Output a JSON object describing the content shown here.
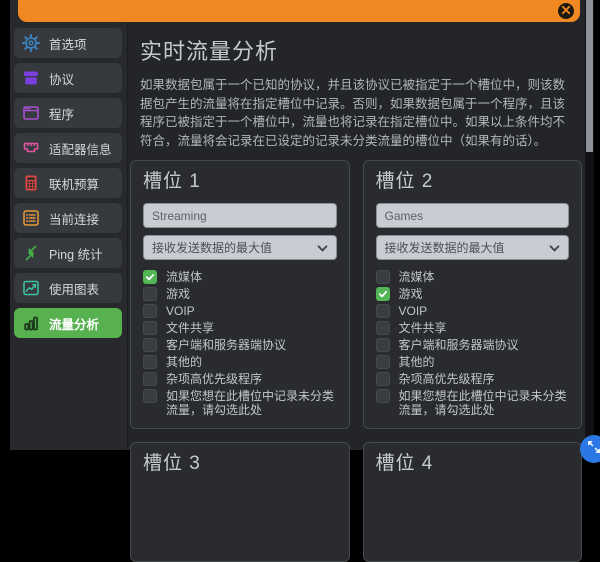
{
  "banner": {
    "close_icon": "✕",
    "color": "#f08921"
  },
  "sidebar": {
    "items": [
      {
        "id": "preferences",
        "label": "首选项",
        "icon": "gear-icon",
        "color": "#3a86c8",
        "active": false
      },
      {
        "id": "protocols",
        "label": "协议",
        "icon": "protocol-box-icon",
        "color": "#7d3ee0",
        "active": false
      },
      {
        "id": "programs",
        "label": "程序",
        "icon": "app-window-icon",
        "color": "#a94fd2",
        "active": false
      },
      {
        "id": "adapter-info",
        "label": "适配器信息",
        "icon": "ethernet-port-icon",
        "color": "#e0559f",
        "active": false
      },
      {
        "id": "online-budget",
        "label": "联机预算",
        "icon": "calculator-icon",
        "color": "#d84b44",
        "active": false
      },
      {
        "id": "current-connections",
        "label": "当前连接",
        "icon": "connection-list-icon",
        "color": "#e89b3c",
        "active": false
      },
      {
        "id": "ping-stats",
        "label": "Ping 统计",
        "icon": "ping-arrows-icon",
        "color": "#46b04a",
        "active": false
      },
      {
        "id": "usage-chart",
        "label": "使用图表",
        "icon": "line-chart-icon",
        "color": "#3cc29e",
        "active": false
      },
      {
        "id": "traffic-analysis",
        "label": "流量分析",
        "icon": "bar-chart-icon",
        "color": "#1d3a1d",
        "active": true
      }
    ]
  },
  "main": {
    "title": "实时流量分析",
    "description": "如果数据包属于一个已知的协议，并且该协议已被指定于一个槽位中，则该数据包产生的流量将在指定槽位中记录。否则，如果数据包属于一个程序，且该程序已被指定于一个槽位中，流量也将记录在指定槽位中。如果以上条件均不符合，流量将会记录在已设定的记录未分类流量的槽位中（如果有的话）。"
  },
  "slots": [
    {
      "title": "槽位 1",
      "name_value": "Streaming",
      "dropdown_value": "接收发送数据的最大值",
      "partial": false,
      "checkboxes": [
        {
          "label": "流媒体",
          "checked": true
        },
        {
          "label": "游戏",
          "checked": false
        },
        {
          "label": "VOIP",
          "checked": false
        },
        {
          "label": "文件共享",
          "checked": false
        },
        {
          "label": "客户端和服务器端协议",
          "checked": false
        },
        {
          "label": "其他的",
          "checked": false
        },
        {
          "label": "杂项高优先级程序",
          "checked": false
        },
        {
          "label": "如果您想在此槽位中记录未分类流量，请勾选此处",
          "checked": false
        }
      ]
    },
    {
      "title": "槽位 2",
      "name_value": "Games",
      "dropdown_value": "接收发送数据的最大值",
      "partial": false,
      "checkboxes": [
        {
          "label": "流媒体",
          "checked": false
        },
        {
          "label": "游戏",
          "checked": true
        },
        {
          "label": "VOIP",
          "checked": false
        },
        {
          "label": "文件共享",
          "checked": false
        },
        {
          "label": "客户端和服务器端协议",
          "checked": false
        },
        {
          "label": "其他的",
          "checked": false
        },
        {
          "label": "杂项高优先级程序",
          "checked": false
        },
        {
          "label": "如果您想在此槽位中记录未分类流量，请勾选此处",
          "checked": false
        }
      ]
    },
    {
      "title": "槽位 3",
      "partial": true
    },
    {
      "title": "槽位 4",
      "partial": true
    }
  ],
  "colors": {
    "accent_orange": "#f08921",
    "active_green": "#56b14e",
    "checkbox_checked": "#53b555",
    "fab_blue": "#2b78e4"
  }
}
